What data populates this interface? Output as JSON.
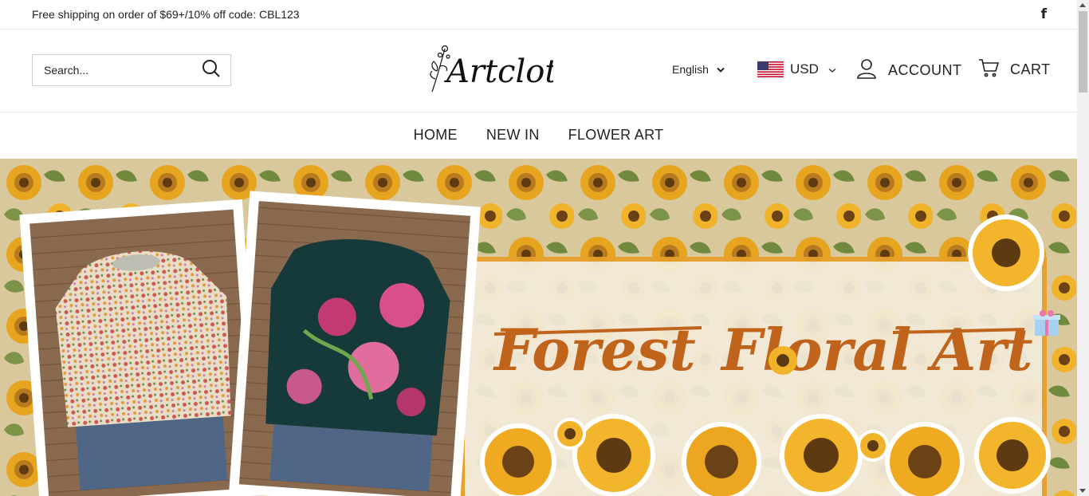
{
  "announcement": {
    "text": "Free shipping on order of $69+/10% off code: CBL123",
    "social_icon": "facebook-icon",
    "facebook_glyph": "f"
  },
  "header": {
    "search": {
      "placeholder": "Search...",
      "icon": "search-icon"
    },
    "logo_text": "Artcloths",
    "language": {
      "selected": "English",
      "icon": "chevron-down-icon"
    },
    "currency": {
      "selected": "USD",
      "icon": "us-flag-icon"
    },
    "account_label": "ACCOUNT",
    "cart_label": "CART"
  },
  "nav": {
    "items": [
      {
        "label": "HOME"
      },
      {
        "label": "NEW IN"
      },
      {
        "label": "FLOWER ART"
      }
    ]
  },
  "hero": {
    "title_part1": "Forest",
    "title_part2": "Floral Art",
    "colors": {
      "title": "#c0641c",
      "border": "#e6a02a",
      "background": "#d9c79a"
    }
  }
}
